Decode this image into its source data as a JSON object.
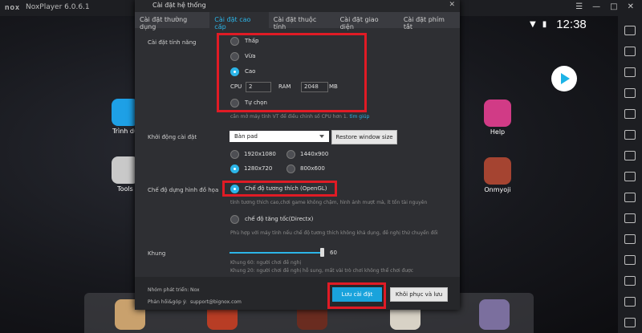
{
  "window": {
    "title": "NoxPlayer 6.0.6.1",
    "logo": "nox"
  },
  "status": {
    "time": "12:38"
  },
  "home_apps": [
    {
      "label": "Trình du",
      "color": "#1ea0e6"
    },
    {
      "label": "Tools",
      "color": "#c9c9c9"
    },
    {
      "label": "Help",
      "color": "#d13b86"
    },
    {
      "label": "Onmyoji",
      "color": "#a54431"
    }
  ],
  "dock_colors": [
    "#c9a16d",
    "#b83d25",
    "#6a2c20",
    "#d8d2c6",
    "#7b6f9e"
  ],
  "dialog": {
    "title": "Cài đặt hệ thống",
    "tabs": [
      "Cài đặt thường dụng",
      "Cài đặt cao cấp",
      "Cài đặt thuộc tính",
      "Cài đặt giao diện",
      "Cài đặt phím tắt"
    ],
    "performance": {
      "label": "Cài đặt tính năng",
      "options": [
        "Thấp",
        "Vừa",
        "Cao",
        "Tự chọn"
      ],
      "selected": "Cao",
      "cpu_label": "CPU",
      "cpu_value": "2",
      "ram_label": "RAM",
      "ram_value": "2048",
      "ram_unit": "MB",
      "hint": "cần mở máy tính VT để điều chỉnh số CPU hơn 1.",
      "hint_link": "tìm giúp"
    },
    "startup": {
      "label": "Khởi động cài đặt",
      "select_value": "Bàn pad",
      "restore_button": "Restore window size",
      "resolutions": [
        "1920x1080",
        "1440x900",
        "1280x720",
        "800x600"
      ],
      "selected": "1280x720"
    },
    "graphics": {
      "label": "Chế độ dựng hình đồ họa",
      "option1": "Chế độ tương thích (OpenGL)",
      "hint1": "tính tương thích cao,chơi game không chậm, hình ảnh mượt mà, ít tốn tài nguyên",
      "option2": "chế độ tăng tốc(Directx)",
      "hint2": "Phù hợp với máy tính nếu chế độ tương thích không khả dụng, đề nghị thử chuyển đổi"
    },
    "frames": {
      "label": "Khung",
      "value": "60",
      "hint1": "Khung 60: người chơi đề nghị",
      "hint2": "Khung 20: người chơi đề nghị hỗ sung, mất vài trò chơi không thể chơi được"
    },
    "footer": {
      "dev_label": "Nhóm phát triển:",
      "dev_value": "Nox",
      "feedback_label": "Phản hồi&góp ý:",
      "feedback_value": "support@bignox.com",
      "save_button": "Lưu cài đặt",
      "reset_button": "Khôi phục và lưu"
    }
  },
  "accent": "#2cb5e8",
  "highlight": "#e01b25"
}
